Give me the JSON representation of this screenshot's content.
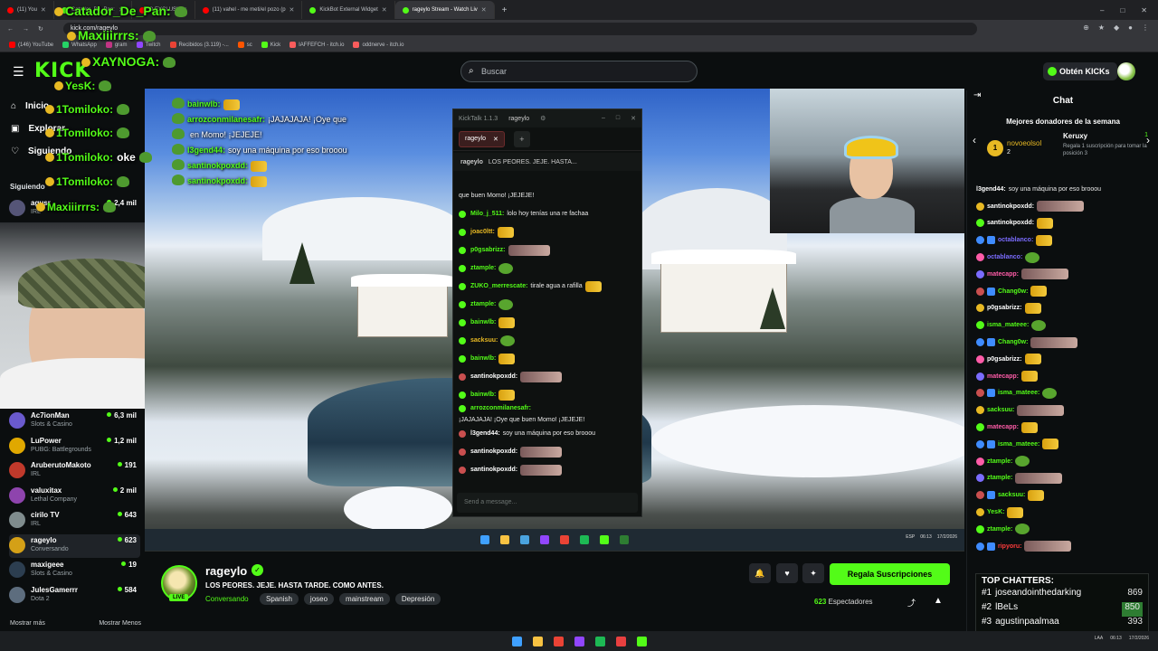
{
  "browser": {
    "tabs": [
      {
        "label": "(11) You",
        "color": "#ff0000"
      },
      {
        "label": "Catador_De_Pan:",
        "color": "#53fc18"
      },
      {
        "label": "O EXCLUSI",
        "color": "#ff0000"
      },
      {
        "label": "(11) vahel - me meti/el pozo (p",
        "color": "#ff0000"
      },
      {
        "label": "KickBot External Widget",
        "color": "#53fc18"
      },
      {
        "label": "rageylo Stream - Watch Liv",
        "color": "#53fc18",
        "active": true
      }
    ],
    "url": "kick.com/rageylo",
    "bookmarks": [
      "(146) YouTube",
      "WhatsApp",
      "gram",
      "Twitch",
      "Recibidos (3.119) -...",
      "sc",
      "Kick",
      "IAFFEFCH - itch.io",
      "oddnerve - itch.io"
    ]
  },
  "header": {
    "logo": "KICK",
    "search_placeholder": "Buscar",
    "obten_label": "Obtén KICKs"
  },
  "sidebar": {
    "nav": [
      {
        "label": "Inicio",
        "icon": "home-icon"
      },
      {
        "label": "Explorar",
        "icon": "explore-icon"
      },
      {
        "label": "Siguiendo",
        "icon": "heart-icon"
      }
    ],
    "section_label": "Siguiendo",
    "first_channel": {
      "name": "agusr",
      "category": "IRL",
      "viewers": "2,4 mil"
    },
    "channels": [
      {
        "name": "Ac7ionMan",
        "category": "Slots & Casino",
        "viewers": "6,3 mil"
      },
      {
        "name": "LuPower",
        "category": "PUBG: Battlegrounds",
        "viewers": "1,2 mil"
      },
      {
        "name": "AruberutoMakoto",
        "category": "IRL",
        "viewers": "191"
      },
      {
        "name": "valuxitax",
        "category": "Lethal Company",
        "viewers": "2 mil"
      },
      {
        "name": "cirilo TV",
        "category": "IRL",
        "viewers": "643"
      },
      {
        "name": "rageylo",
        "category": "Conversando",
        "viewers": "623",
        "selected": true
      },
      {
        "name": "maxigeee",
        "category": "Slots & Casino",
        "viewers": "19"
      },
      {
        "name": "JulesGamerrr",
        "category": "Dota 2",
        "viewers": "584"
      }
    ],
    "show_more": "Mostrar más",
    "show_less": "Mostrar Menos"
  },
  "overlay_chat": [
    {
      "user": "Catador_De_Pan:",
      "color": "#53fc18"
    },
    {
      "user": "Maxiiirrrs:",
      "color": "#53fc18"
    },
    {
      "user": "XAYNOGA:",
      "color": "#53fc18"
    },
    {
      "user": "YesK:",
      "color": "#53fc18"
    },
    {
      "user": "1Tomiloko:",
      "color": "#53fc18",
      "text": ""
    },
    {
      "user": "1Tomiloko:",
      "color": "#53fc18",
      "text": ""
    },
    {
      "user": "1Tomiloko:",
      "color": "#53fc18",
      "text": "oke"
    },
    {
      "user": "1Tomiloko:",
      "color": "#53fc18",
      "text": ""
    },
    {
      "user": "Maxiiirrrs:",
      "color": "#53fc18"
    }
  ],
  "stream_overlay_msgs": [
    {
      "user": "bainwlb:",
      "text": ""
    },
    {
      "user": "arrozconmilanesafr:",
      "text": "¡JAJAJAJA! ¡Oye que"
    },
    {
      "user": "",
      "text": "en Momo! ¡JEJEJE!"
    },
    {
      "user": "l3gend44:",
      "text": "soy una máquina por eso brooou"
    },
    {
      "user": "santinokpoxdd:",
      "text": ""
    },
    {
      "user": "santinokpoxdd:",
      "text": ""
    }
  ],
  "kicktalk": {
    "title": "KickTalk 1.1.3",
    "channel": "rageylo",
    "tab_label": "rageylo",
    "pinned_user": "rageylo",
    "pinned_text": "LOS PEORES. JEJE. HASTA...",
    "messages": [
      {
        "user": "",
        "text": "que buen Momo! ¡JEJEJE!",
        "ucolor": "#ffffff",
        "emote": ""
      },
      {
        "user": "Milo_j_511:",
        "text": "lolo hoy tenías una re fachaa",
        "ucolor": "#53fc18",
        "emote": ""
      },
      {
        "user": "joac0ltt:",
        "text": "",
        "ucolor": "#e8b923",
        "emote": "y"
      },
      {
        "user": "p0gsabrizz:",
        "text": "",
        "ucolor": "#53fc18",
        "emote": "w"
      },
      {
        "user": "ztample:",
        "text": "",
        "ucolor": "#53fc18",
        "emote": "g"
      },
      {
        "user": "ZUKO_merrescate:",
        "text": "tirale agua a rafilla",
        "ucolor": "#53fc18",
        "emote": "y"
      },
      {
        "user": "ztample:",
        "text": "",
        "ucolor": "#53fc18",
        "emote": "g"
      },
      {
        "user": "bainwlb:",
        "text": "",
        "ucolor": "#53fc18",
        "emote": "y"
      },
      {
        "user": "sacksuu:",
        "text": "",
        "ucolor": "#e8b923",
        "emote": "g"
      },
      {
        "user": "bainwlb:",
        "text": "",
        "ucolor": "#53fc18",
        "emote": "y"
      },
      {
        "user": "santinokpoxdd:",
        "text": "",
        "ucolor": "#ffffff",
        "emote": "w"
      },
      {
        "user": "bainwlb:",
        "text": "",
        "ucolor": "#53fc18",
        "emote": "y"
      },
      {
        "user": "arrozconmilanesafr:",
        "text": "¡JAJAJAJA! ¡Oye que buen Momo! ¡JEJEJE!",
        "ucolor": "#53fc18",
        "emote": ""
      },
      {
        "user": "l3gend44:",
        "text": "soy una máquina por eso brooou",
        "ucolor": "#ffffff",
        "emote": ""
      },
      {
        "user": "santinokpoxdd:",
        "text": "",
        "ucolor": "#ffffff",
        "emote": "w"
      },
      {
        "user": "santinokpoxdd:",
        "text": "",
        "ucolor": "#ffffff",
        "emote": "w"
      }
    ],
    "input_placeholder": "Send a message..."
  },
  "stream_info": {
    "streamer": "rageylo",
    "live_label": "LIVE",
    "title": "LOS PEORES. JEJE. HASTA TARDE. COMO ANTES.",
    "category": "Conversando",
    "tags": [
      "Spanish",
      "joseo",
      "mainstream",
      "Depresión"
    ],
    "gift_button": "Regala Suscripciones",
    "viewer_count": "623",
    "viewer_label": "Espectadores"
  },
  "chat": {
    "title": "Chat",
    "donors_title": "Mejores donadores de la semana",
    "donor1": {
      "rank": "1",
      "name": "novoeolsol",
      "count": "2"
    },
    "donor2": {
      "name": "Keruxy",
      "count": "1",
      "promo": "Regala 1 suscripción para tomar la posición 3"
    },
    "messages": [
      {
        "user": "l3gend44:",
        "text": "soy una máquina por eso brooou",
        "color": "#ffffff"
      },
      {
        "user": "santinokpoxdd:",
        "text": "",
        "color": "#ffffff"
      },
      {
        "user": "santinokpoxdd:",
        "text": "",
        "color": "#ffffff"
      },
      {
        "user": "octablanco:",
        "text": "",
        "color": "#7b6cff"
      },
      {
        "user": "octablanco:",
        "text": "",
        "color": "#7b6cff"
      },
      {
        "user": "matecapp:",
        "text": "",
        "color": "#ff5ca8"
      },
      {
        "user": "Chang0w:",
        "text": "",
        "color": "#53fc18"
      },
      {
        "user": "p0gsabrizz:",
        "text": "",
        "color": "#ffffff"
      },
      {
        "user": "isma_mateee:",
        "text": "",
        "color": "#53fc18"
      },
      {
        "user": "Chang0w:",
        "text": "",
        "color": "#53fc18"
      },
      {
        "user": "p0gsabrizz:",
        "text": "",
        "color": "#ffffff"
      },
      {
        "user": "matecapp:",
        "text": "",
        "color": "#ff5ca8"
      },
      {
        "user": "isma_mateee:",
        "text": "",
        "color": "#53fc18"
      },
      {
        "user": "sacksuu:",
        "text": "",
        "color": "#53fc18"
      },
      {
        "user": "matecapp:",
        "text": "",
        "color": "#ff5ca8"
      },
      {
        "user": "isma_mateee:",
        "text": "",
        "color": "#53fc18"
      },
      {
        "user": "ztample:",
        "text": "",
        "color": "#53fc18"
      },
      {
        "user": "ztample:",
        "text": "",
        "color": "#53fc18"
      },
      {
        "user": "sacksuu:",
        "text": "",
        "color": "#53fc18"
      },
      {
        "user": "YesK:",
        "text": "",
        "color": "#53fc18"
      },
      {
        "user": "ztample:",
        "text": "",
        "color": "#53fc18"
      },
      {
        "user": "ripyoru:",
        "text": "",
        "color": "#ff3b3b"
      }
    ]
  },
  "top_chatters": {
    "title": "TOP CHATTERS:",
    "rows": [
      {
        "rank": "#1",
        "name": "joseandointhedarking",
        "count": "869"
      },
      {
        "rank": "#2",
        "name": "lBeLs",
        "count": "850"
      },
      {
        "rank": "#3",
        "name": "agustinpaalmaa",
        "count": "393"
      }
    ]
  },
  "taskbar": {
    "lang": "ESP",
    "lang2": "LAA",
    "time": "06:13",
    "date": "17/2/2026"
  },
  "colors": {
    "kick_green": "#53fc18",
    "background": "#0b0e0f"
  }
}
